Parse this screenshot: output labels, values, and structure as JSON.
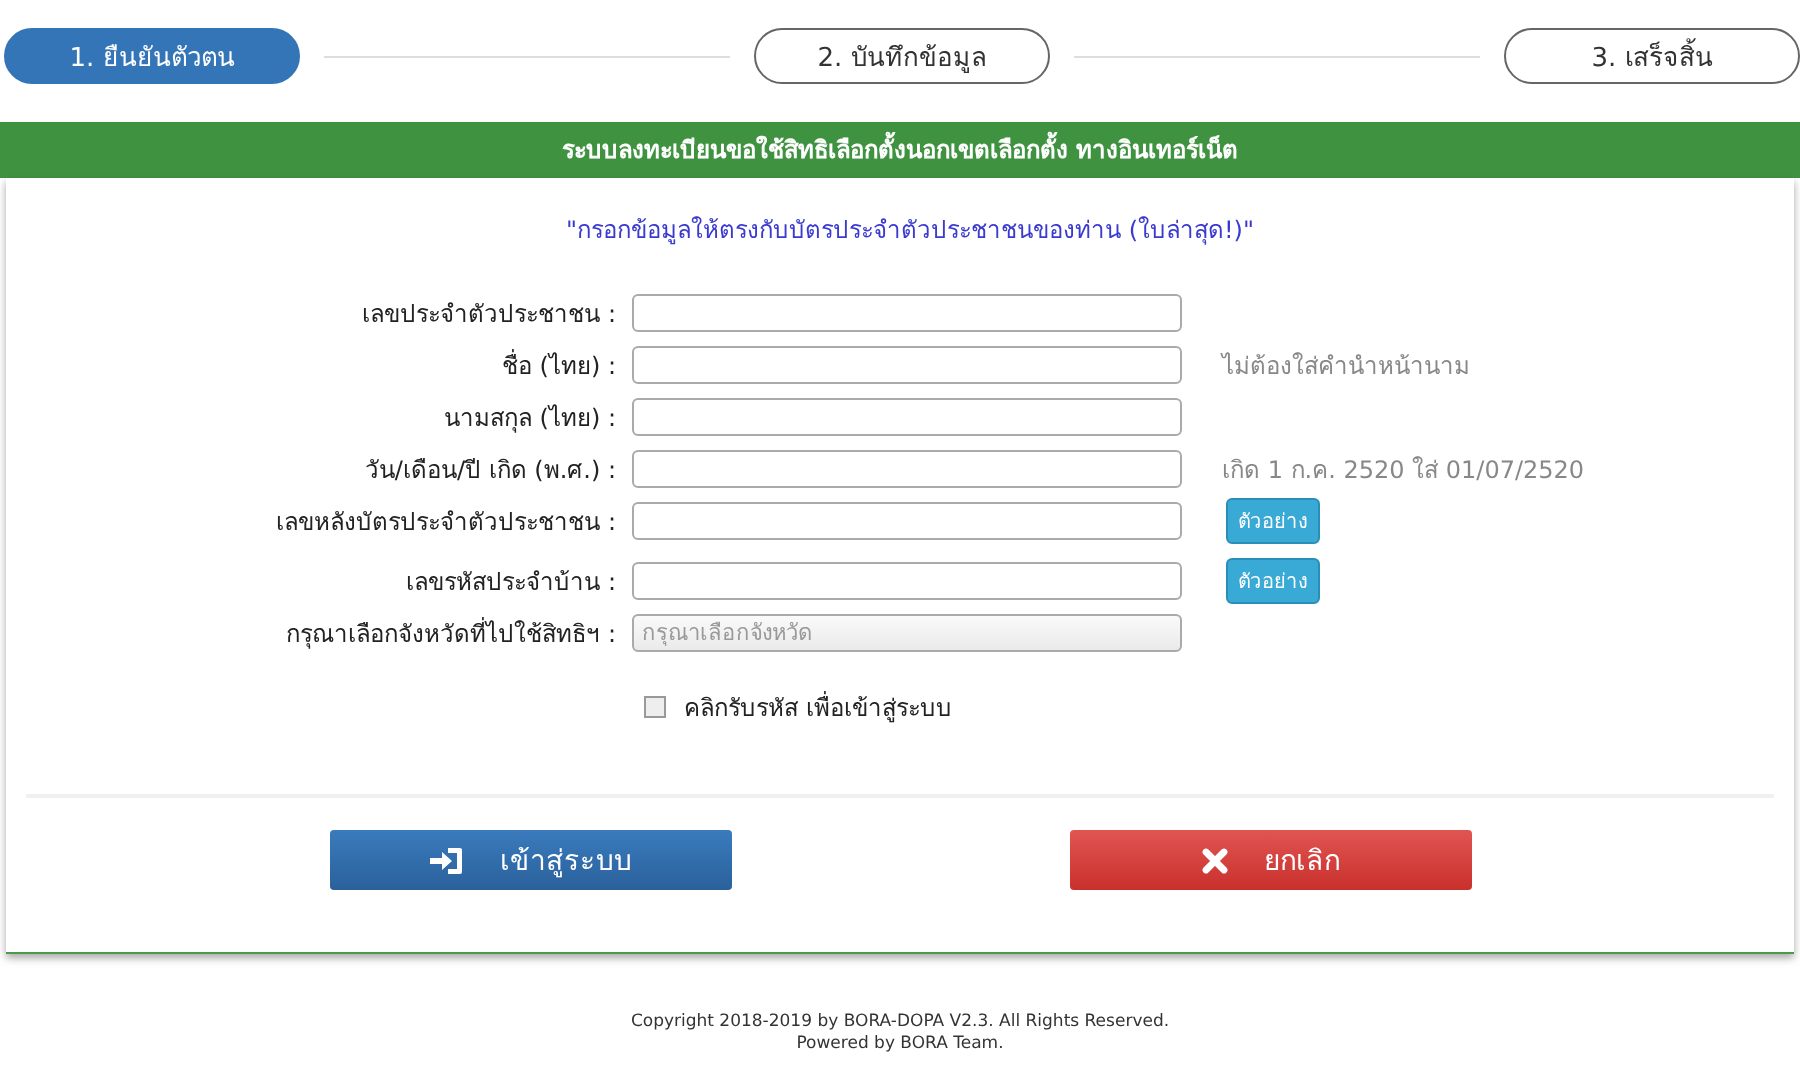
{
  "steps": [
    {
      "label": "1. ยืนยันตัวตน",
      "selected": true
    },
    {
      "label": "2. บันทึกข้อมูล",
      "selected": false
    },
    {
      "label": "3. เสร็จสิ้น",
      "selected": false
    }
  ],
  "banner": "ระบบลงทะเบียนขอใช้สิทธิเลือกตั้งนอกเขตเลือกตั้ง ทางอินเทอร์เน็ต",
  "instruction": "\"กรอกข้อมูลให้ตรงกับบัตรประจำตัวประชาชนของท่าน (ใบล่าสุด!)\"",
  "fields": [
    {
      "label": "เลขประจำตัวประชาชน :",
      "kind": "text"
    },
    {
      "label": "ชื่อ (ไทย) :",
      "kind": "text",
      "hint": "ไม่ต้องใส่คำนำหน้านาม"
    },
    {
      "label": "นามสกุล (ไทย) :",
      "kind": "text"
    },
    {
      "label": "วัน/เดือน/ปี เกิด (พ.ศ.) :",
      "kind": "text",
      "hint": "เกิด 1 ก.ค. 2520 ใส่ 01/07/2520"
    },
    {
      "label": "เลขหลังบัตรประจำตัวประชาชน :",
      "kind": "text",
      "example_button": "ตัวอย่าง"
    },
    {
      "label": "เลขรหัสประจำบ้าน :",
      "kind": "text",
      "example_button": "ตัวอย่าง"
    },
    {
      "label": "กรุณาเลือกจังหวัดที่ไปใช้สิทธิฯ :",
      "kind": "select",
      "placeholder": "กรุณาเลือกจังหวัด"
    }
  ],
  "consent": {
    "label": "คลิกรับรหัส เพื่อเข้าสู่ระบบ",
    "checked": false
  },
  "buttons": [
    {
      "label": "เข้าสู่ระบบ",
      "kind": "login"
    },
    {
      "label": "ยกเลิก",
      "kind": "cancel"
    }
  ],
  "footer": [
    "Copyright 2018-2019 by BORA-DOPA V2.3. All Rights Reserved.",
    "Powered by BORA Team."
  ]
}
